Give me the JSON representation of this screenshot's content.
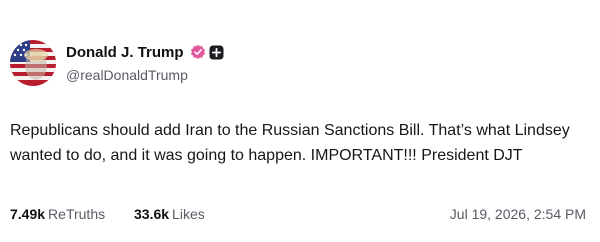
{
  "author": {
    "display_name": "Donald J. Trump",
    "handle": "@realDonaldTrump",
    "verified_icon": "verified-badge-icon",
    "plus_icon": "plus-icon",
    "verified_color": "#e2569e"
  },
  "post": {
    "text": "Republicans should add Iran to the Russian Sanctions Bill. That’s what Lindsey wanted to do, and it was going to happen. IMPORTANT!!! President DJT",
    "retruths_count": "7.49k",
    "retruths_label": "ReTruths",
    "likes_count": "33.6k",
    "likes_label": "Likes",
    "timestamp": "Jul 19, 2026, 2:54 PM"
  }
}
